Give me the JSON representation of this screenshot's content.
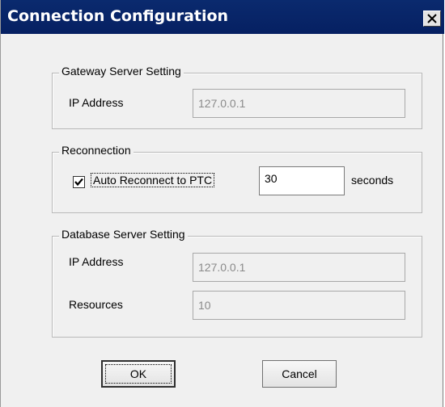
{
  "window": {
    "title": "Connection Configuration",
    "close_glyph": "✕"
  },
  "gateway": {
    "group_label": "Gateway Server Setting",
    "ip_label": "IP Address",
    "ip_value": "127.0.0.1"
  },
  "reconnection": {
    "group_label": "Reconnection",
    "checkbox_label": "Auto Reconnect to PTC",
    "checked": true,
    "interval_value": "30",
    "unit_label": "seconds"
  },
  "database": {
    "group_label": "Database Server Setting",
    "ip_label": "IP Address",
    "ip_value": "127.0.0.1",
    "resources_label": "Resources",
    "resources_value": "10"
  },
  "buttons": {
    "ok": "OK",
    "cancel": "Cancel"
  }
}
